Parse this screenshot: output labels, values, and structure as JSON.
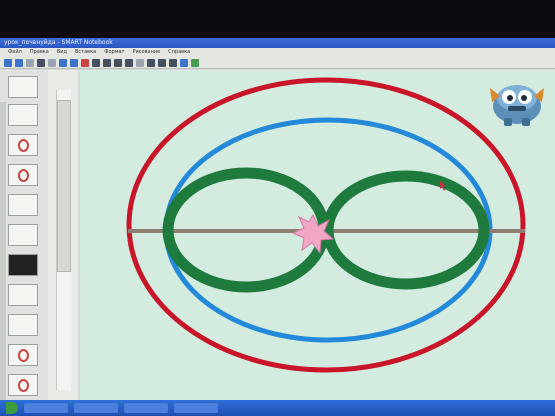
{
  "window": {
    "title": "урок_почвнуйда - SMART Notebook",
    "menu": [
      "Файл",
      "Правка",
      "Вид",
      "Вставка",
      "Формат",
      "Рисование",
      "Справка"
    ]
  },
  "sidebar": {
    "thumb_count": 12
  },
  "colors": {
    "outer_ellipse": "#c8152a",
    "middle_ellipse": "#2389d8",
    "figure_eight": "#1f7a3e",
    "axis_line": "#8f7f73",
    "star": "#f2a6c6",
    "canvas": "#d3ecdf"
  },
  "icons": {
    "toolbar": [
      "back-icon",
      "forward-icon",
      "page-icon",
      "save-icon",
      "print-icon",
      "undo-icon",
      "redo-icon",
      "delete-icon",
      "screen-icon",
      "table-icon",
      "select-icon",
      "pen-icon",
      "eraser-icon",
      "line-icon",
      "shape-icon",
      "text-icon",
      "fill-icon",
      "properties-icon"
    ],
    "mascot": "robot-mascot-icon",
    "cursor": "arrow-cursor-icon"
  }
}
